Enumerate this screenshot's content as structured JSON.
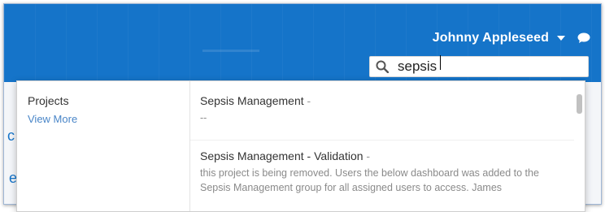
{
  "header": {
    "user_name": "Johnny Appleseed"
  },
  "search": {
    "value": "sepsis",
    "placeholder": ""
  },
  "dropdown": {
    "section_title": "Projects",
    "view_more": "View More",
    "results": [
      {
        "name": "Sepsis Management",
        "separator": " -",
        "description": "--"
      },
      {
        "name": "Sepsis Management - Validation",
        "separator": " -",
        "description": "this project is being removed. Users the below dashboard was added to the Sepsis Management group for all assigned users to access. James"
      }
    ]
  },
  "background": {
    "partial_letters": [
      "c",
      "e"
    ]
  },
  "colors": {
    "topbar": "#1574c9",
    "link": "#4a86c8"
  },
  "icons": {
    "user_menu": "caret-down-icon",
    "chat": "chat-bubble-icon",
    "search": "search-icon"
  }
}
